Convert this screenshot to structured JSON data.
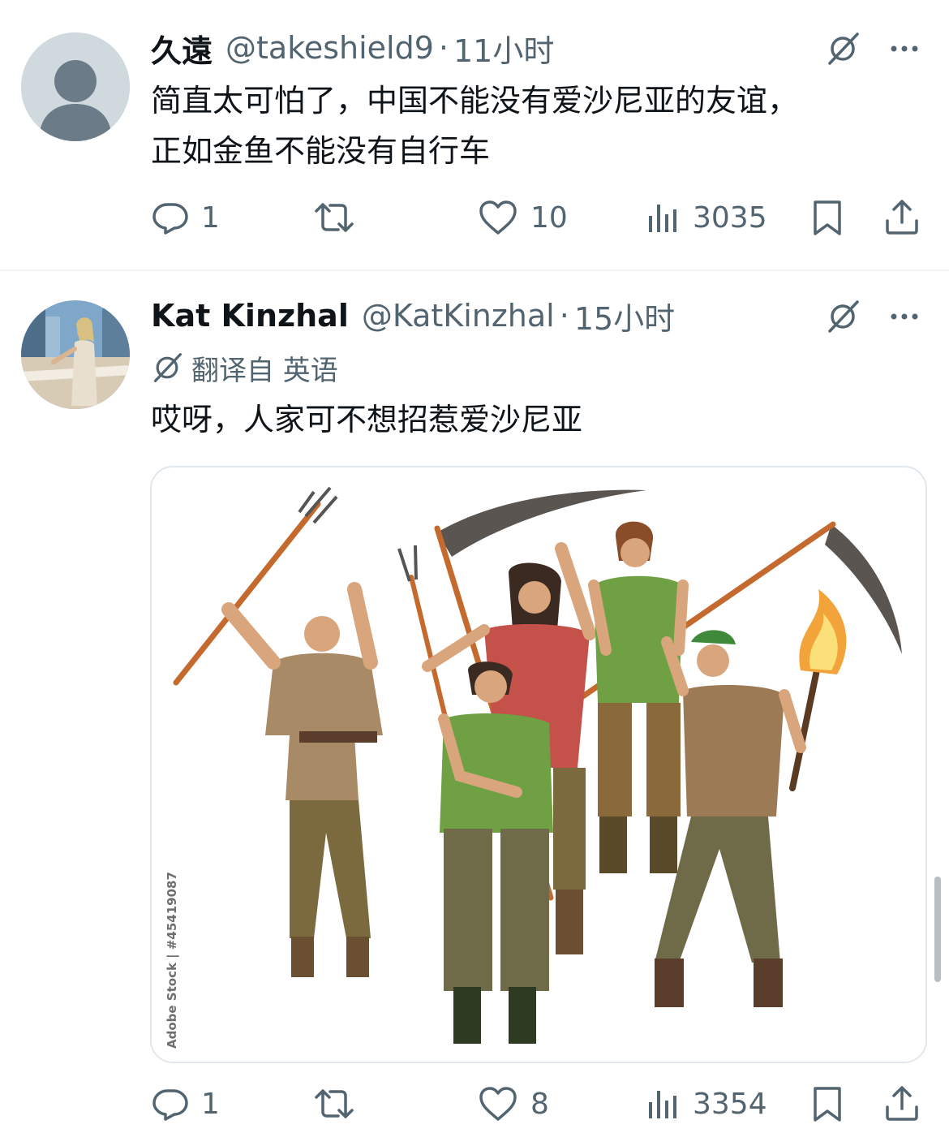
{
  "tweets": [
    {
      "author_name": "久遠",
      "handle": "@takeshield9",
      "separator": "·",
      "time": "11小时",
      "text_lines": [
        "简直太可怕了，中国不能没有爱沙尼亚的友谊，",
        "正如金鱼不能没有自行车"
      ],
      "replies": "1",
      "retweets": "",
      "likes": "10",
      "views": "3035"
    },
    {
      "author_name": "Kat Kinzhal",
      "handle": "@KatKinzhal",
      "separator": "·",
      "time": "15小时",
      "translated_label": "翻译自 英语",
      "text_lines": [
        "哎呀，人家可不想招惹爱沙尼亚"
      ],
      "media_watermark": "Adobe Stock | #45419087",
      "replies": "1",
      "retweets": "",
      "likes": "8",
      "views": "3354"
    }
  ],
  "colors": {
    "text_primary": "#0f1419",
    "text_secondary": "#536471",
    "divider": "#eff3f4"
  },
  "icons": [
    "grok-icon",
    "more-icon",
    "reply-icon",
    "retweet-icon",
    "like-icon",
    "views-icon",
    "bookmark-icon",
    "share-icon",
    "translate-icon"
  ]
}
